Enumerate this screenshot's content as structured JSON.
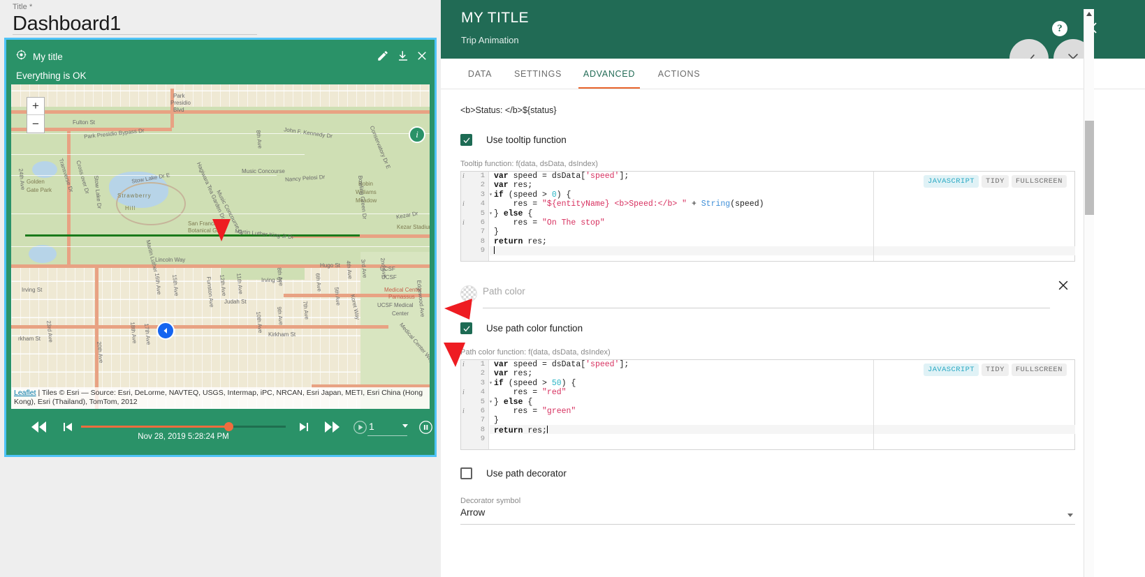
{
  "dashboard": {
    "title_label": "Title *",
    "title_value": "Dashboard1"
  },
  "widget": {
    "title": "My title",
    "subtitle": "Everything is OK",
    "icons": {
      "target": "target-icon",
      "edit": "edit-pencil-icon",
      "download": "download-icon",
      "close": "close-icon"
    },
    "map": {
      "zoom_in": "+",
      "zoom_out": "−",
      "info_badge": "i",
      "attribution_link": "Leaflet",
      "attribution_text": " | Tiles © Esri — Source: Esri, DeLorme, NAVTEQ, USGS, Intermap, iPC, NRCAN, Esri Japan, METI, Esri China (Hong Kong), Esri (Thailand), TomTom, 2012",
      "labels": [
        "Fulton St",
        "Park Presidio Bypass Dr",
        "Park Presidio Blvd",
        "Golden Gate Park",
        "Transverse Dr",
        "Cross over Dr",
        "Stow Lake Dr",
        "Stow Lake Dr E",
        "Strawberry Hill",
        "San Francisco Botanical Gar",
        "Hagiwara Tea Garden Dr",
        "Music Concourse Dr",
        "John F. Kennedy Dr",
        "Nancy Pelosi Dr",
        "Conservatory Dr E",
        "Robin Williams Meadow",
        "Bowling Green Dr",
        "Kezar Dr",
        "Kezar Stadium",
        "Martin Luther King Jr Dr",
        "Lincoln Way",
        "Irving St",
        "Judah St",
        "Kirkham St",
        "Hugo St",
        "UCSF Medical Center Parnassus",
        "UCSF Medical Center",
        "Medical Center Way",
        "Funston Ave",
        "Edgewood Ave",
        "Koret Way",
        "3rd Ave",
        "4th Ave",
        "5th Ave",
        "6th Ave",
        "7th Ave",
        "8th Ave",
        "9th Ave",
        "10th Ave",
        "11th Ave",
        "12th Ave",
        "15th Ave",
        "16th Ave",
        "17th Ave",
        "18th Ave",
        "20th Ave",
        "23rd Ave",
        "24th Ave"
      ]
    },
    "timeline": {
      "date": "Nov 28, 2019 5:28:24 PM",
      "speed": "1",
      "icons": {
        "rewind": "fast-rewind-icon",
        "skip_prev": "skip-previous-icon",
        "skip_next": "skip-next-icon",
        "forward": "fast-forward-icon",
        "play": "play-circle-icon",
        "pause": "pause-circle-icon"
      }
    }
  },
  "panel": {
    "title": "MY TITLE",
    "subtitle": "Trip Animation",
    "help_icon": "help-icon",
    "close_icon": "close-icon",
    "accept_icon": "checkmark-icon",
    "reject_icon": "cross-icon",
    "tabs": [
      {
        "label": "DATA",
        "active": false
      },
      {
        "label": "SETTINGS",
        "active": false
      },
      {
        "label": "ADVANCED",
        "active": true
      },
      {
        "label": "ACTIONS",
        "active": false
      }
    ],
    "accent_color": "#e8642c",
    "header_color": "#216b55"
  },
  "advanced": {
    "tooltip_pattern_tail": "<b>Status: </b>${status}",
    "use_tooltip_function": {
      "label": "Use tooltip function",
      "checked": true
    },
    "tooltip_function_label": "Tooltip function: f(data, dsData, dsIndex)",
    "tooltip_code": {
      "language_badge": "JAVASCRIPT",
      "tidy_badge": "TIDY",
      "fullscreen_badge": "FULLSCREEN",
      "lines": [
        {
          "n": 1,
          "info": true,
          "fold": false,
          "text": "var speed = dsData['speed'];"
        },
        {
          "n": 2,
          "info": false,
          "fold": false,
          "text": "var res;"
        },
        {
          "n": 3,
          "info": false,
          "fold": true,
          "text": "if (speed > 0) {"
        },
        {
          "n": 4,
          "info": true,
          "fold": false,
          "text": "    res = \"${entityName} <b>Speed:</b> \" + String(speed)"
        },
        {
          "n": 5,
          "info": false,
          "fold": true,
          "text": "} else {"
        },
        {
          "n": 6,
          "info": true,
          "fold": false,
          "text": "    res = \"On The stop\""
        },
        {
          "n": 7,
          "info": false,
          "fold": false,
          "text": "}"
        },
        {
          "n": 8,
          "info": false,
          "fold": false,
          "text": "return res;"
        },
        {
          "n": 9,
          "info": false,
          "fold": false,
          "text": ""
        }
      ]
    },
    "path_color": {
      "placeholder": "Path color",
      "value": "",
      "swatch_name": "color-swatch",
      "clear_icon": "clear-icon"
    },
    "use_path_color_function": {
      "label": "Use path color function",
      "checked": true
    },
    "path_color_function_label": "Path color function: f(data, dsData, dsIndex)",
    "path_color_code": {
      "language_badge": "JAVASCRIPT",
      "tidy_badge": "TIDY",
      "fullscreen_badge": "FULLSCREEN",
      "lines": [
        {
          "n": 1,
          "info": true,
          "fold": false,
          "text": "var speed = dsData['speed'];"
        },
        {
          "n": 2,
          "info": false,
          "fold": false,
          "text": "var res;"
        },
        {
          "n": 3,
          "info": false,
          "fold": true,
          "text": "if (speed > 50) {"
        },
        {
          "n": 4,
          "info": true,
          "fold": false,
          "text": "    res = \"red\""
        },
        {
          "n": 5,
          "info": false,
          "fold": true,
          "text": "} else {"
        },
        {
          "n": 6,
          "info": true,
          "fold": false,
          "text": "    res = \"green\""
        },
        {
          "n": 7,
          "info": false,
          "fold": false,
          "text": "}"
        },
        {
          "n": 8,
          "info": false,
          "fold": false,
          "text": "return res;"
        },
        {
          "n": 9,
          "info": false,
          "fold": false,
          "text": ""
        }
      ]
    },
    "use_path_decorator": {
      "label": "Use path decorator",
      "checked": false
    },
    "decorator_symbol_label": "Decorator symbol",
    "decorator_symbol_value": "Arrow"
  }
}
